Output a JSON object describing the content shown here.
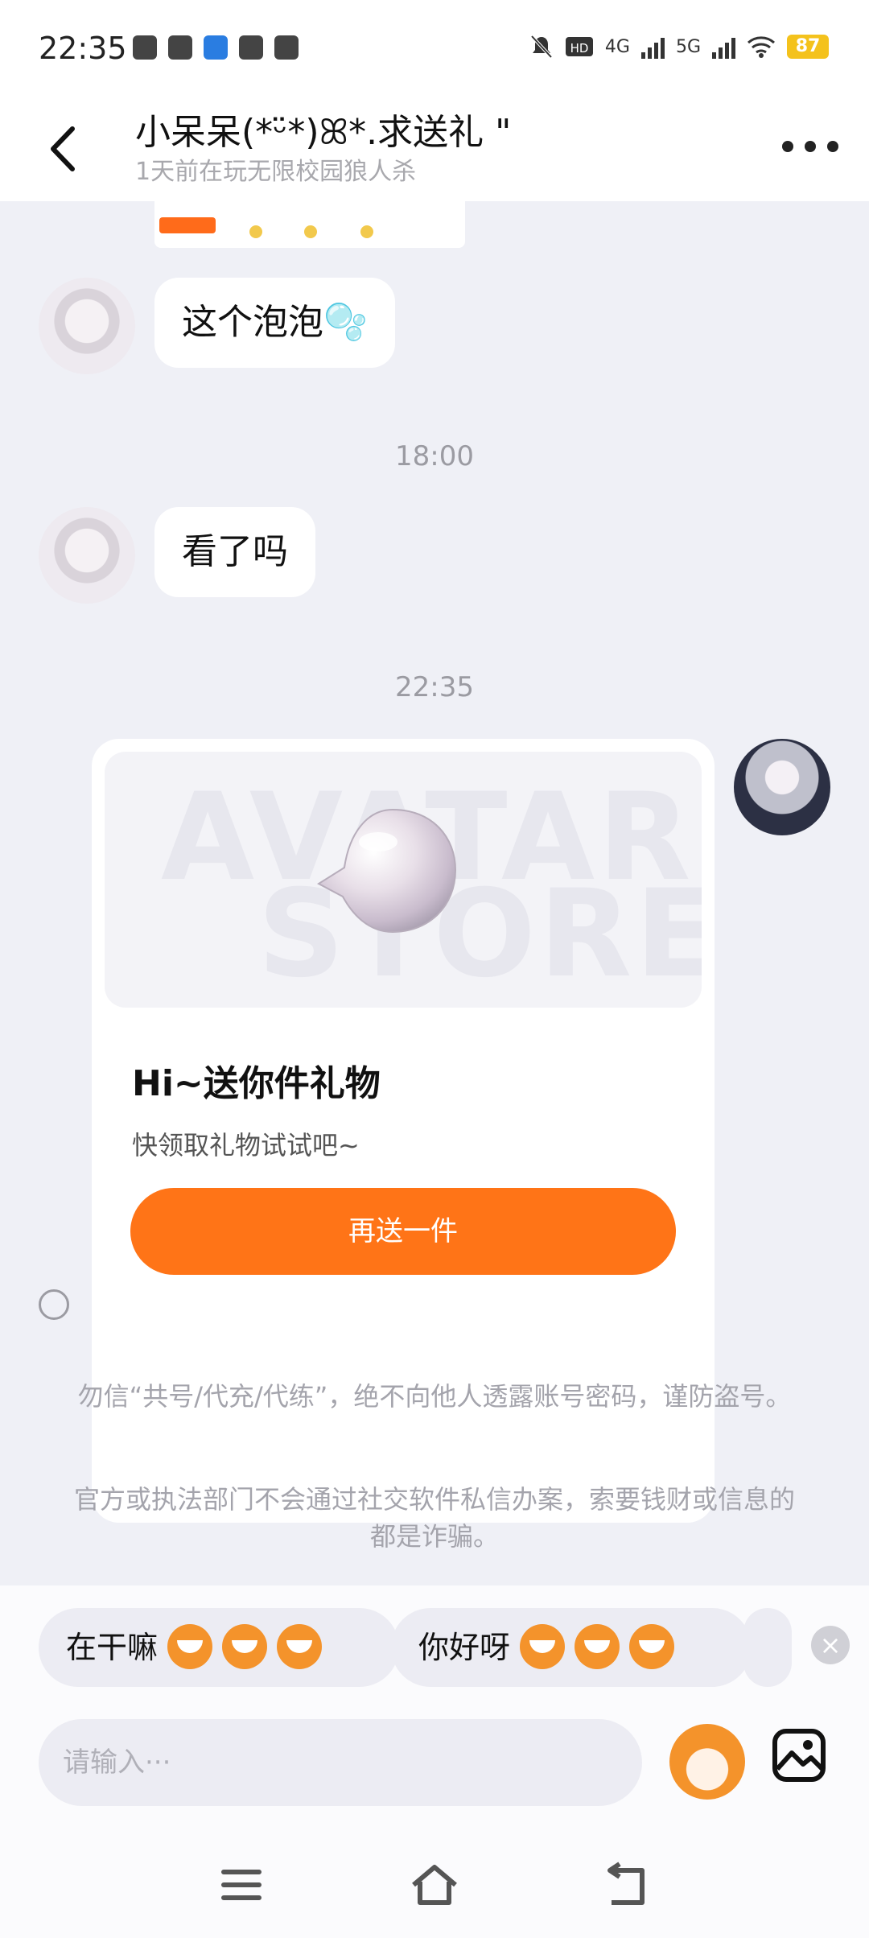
{
  "status_bar": {
    "time": "22:35",
    "battery": "87",
    "network_1": "4G",
    "network_2": "5G",
    "icons": [
      "qq-icon",
      "wechat-icon",
      "app-icon",
      "weibo-icon",
      "alipay-icon",
      "mute-icon",
      "hd-icon",
      "wifi-icon"
    ]
  },
  "header": {
    "title": "小呆呆(*ᵕ̈*)ꕤ*.求送礼 \"",
    "subtitle": "1天前在玩无限校园狼人杀"
  },
  "messages": [
    {
      "sender": "other",
      "text": "这个泡泡🫧"
    },
    {
      "time": "18:00"
    },
    {
      "sender": "other",
      "text": "看了吗"
    },
    {
      "time": "22:35"
    }
  ],
  "gift_card": {
    "title": "Hi~送你件礼物",
    "subtitle": "快领取礼物试试吧~",
    "button": "再送一件",
    "watermark_1": "AVATAR",
    "watermark_2": "STORE"
  },
  "warnings": [
    "勿信“共号/代充/代练”，绝不向他人透露账号密码，谨防盗号。",
    "官方或执法部门不会通过社交软件私信办案，索要钱财或信息的都是诈骗。"
  ],
  "quick_replies": [
    "在干嘛",
    "你好呀"
  ],
  "input": {
    "placeholder": "请输入···"
  },
  "colors": {
    "accent": "#ff7417",
    "background": "#eff0f6"
  }
}
